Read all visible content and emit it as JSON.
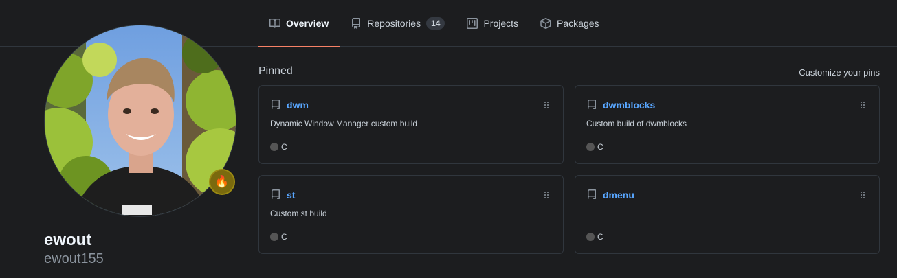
{
  "nav": {
    "tabs": [
      {
        "label": "Overview",
        "icon": "book-icon",
        "active": true
      },
      {
        "label": "Repositories",
        "icon": "repo-icon",
        "count": "14"
      },
      {
        "label": "Projects",
        "icon": "project-icon"
      },
      {
        "label": "Packages",
        "icon": "package-icon"
      }
    ]
  },
  "profile": {
    "display_name": "ewout",
    "username": "ewout155",
    "status_emoji": "🔥"
  },
  "pinned": {
    "heading": "Pinned",
    "customize_label": "Customize your pins",
    "repos": [
      {
        "name": "dwm",
        "description": "Dynamic Window Manager custom build",
        "language": "C",
        "language_color": "#555555"
      },
      {
        "name": "dwmblocks",
        "description": "Custom build of dwmblocks",
        "language": "C",
        "language_color": "#555555"
      },
      {
        "name": "st",
        "description": "Custom st build",
        "language": "C",
        "language_color": "#555555"
      },
      {
        "name": "dmenu",
        "description": "",
        "language": "C",
        "language_color": "#555555"
      }
    ]
  },
  "colors": {
    "background": "#1c1d1f",
    "link": "#58a6ff",
    "active_tab_underline": "#f78166",
    "border": "#30363d"
  }
}
